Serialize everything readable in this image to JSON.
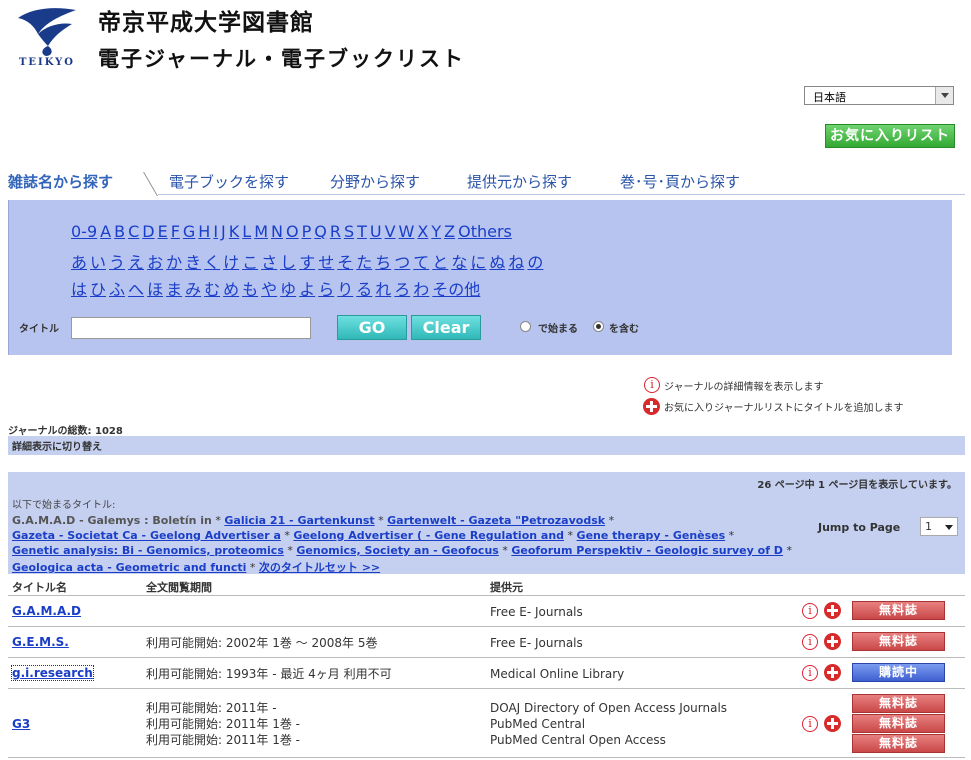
{
  "header": {
    "logo_text": "TEIKYO",
    "library_title": "帝京平成大学図書館",
    "list_title": "電子ジャーナル・電子ブックリスト",
    "language_selected": "日本語",
    "favorites_button": "お気に入りリスト"
  },
  "tabs": [
    {
      "label": "雑誌名から探す",
      "active": true
    },
    {
      "label": "電子ブックを探す",
      "active": false
    },
    {
      "label": "分野から探す",
      "active": false
    },
    {
      "label": "提供元から探す",
      "active": false
    },
    {
      "label": "巻･号･頁から探す",
      "active": false
    }
  ],
  "search": {
    "alpha_latin": [
      "0-9",
      "A",
      "B",
      "C",
      "D",
      "E",
      "F",
      "G",
      "H",
      "I",
      "J",
      "K",
      "L",
      "M",
      "N",
      "O",
      "P",
      "Q",
      "R",
      "S",
      "T",
      "U",
      "V",
      "W",
      "X",
      "Y",
      "Z",
      "Others"
    ],
    "alpha_kana1": [
      "あ",
      "い",
      "う",
      "え",
      "お",
      "か",
      "き",
      "く",
      "け",
      "こ",
      "さ",
      "し",
      "す",
      "せ",
      "そ",
      "た",
      "ち",
      "つ",
      "て",
      "と",
      "な",
      "に",
      "ぬ",
      "ね",
      "の"
    ],
    "alpha_kana2": [
      "は",
      "ひ",
      "ふ",
      "へ",
      "ほ",
      "ま",
      "み",
      "む",
      "め",
      "も",
      "や",
      "ゆ",
      "よ",
      "ら",
      "り",
      "る",
      "れ",
      "ろ",
      "わ",
      "その他"
    ],
    "title_label": "タイトル",
    "title_value": "",
    "go_button": "GO",
    "clear_button": "Clear",
    "radio_starts": "で始まる",
    "radio_contains": "を含む",
    "radio_selected": "contains"
  },
  "legend": {
    "info_text": "ジャーナルの詳細情報を表示します",
    "add_text": "お気に入りジャーナルリストにタイトルを追加します"
  },
  "total_text": "ジャーナルの総数: 1028",
  "detail_toggle": "詳細表示に切り替え",
  "index": {
    "page_info": "26 ページ中 1 ページ目を表示しています。",
    "label": "以下で始まるタイトル:",
    "line1_plain": "G.A.M.A.D - Galemys : Boletín in",
    "line1_links": [
      "Galicia 21 - Gartenkunst",
      "Gartenwelt - Gazeta \"Petrozavodsk"
    ],
    "line2_links": [
      "Gazeta - Societat Ca - Geelong Advertiser a",
      "Geelong Advertiser ( - Gene Regulation and",
      "Gene therapy - Genèses"
    ],
    "line3_links": [
      "Genetic analysis: Bi - Genomics, proteomics",
      "Genomics, Society an - Geofocus",
      "Geoforum Perspektiv - Geologic survey of D"
    ],
    "line4_links": [
      "Geologica acta - Geometric and functi"
    ],
    "next_set": "次のタイトルセット >>",
    "sep": " * ",
    "jump_label": "Jump to Page",
    "jump_value": "1"
  },
  "table": {
    "headers": {
      "title": "タイトル名",
      "period": "全文閲覧期間",
      "provider": "提供元"
    },
    "rows": [
      {
        "title": "G.A.M.A.D",
        "periods": [],
        "providers": [
          "Free E- Journals"
        ],
        "badges": [
          "無料誌"
        ]
      },
      {
        "title": "G.E.M.S.",
        "periods": [
          "利用可能開始: 2002年 1巻 〜 2008年 5巻"
        ],
        "providers": [
          "Free E- Journals"
        ],
        "badges": [
          "無料誌"
        ]
      },
      {
        "title": "g.i.research",
        "periods": [
          "利用可能開始: 1993年 - 最近 4ヶ月 利用不可"
        ],
        "providers": [
          "Medical Online Library"
        ],
        "badges": [
          "購読中"
        ]
      },
      {
        "title": "G3",
        "periods": [
          "利用可能開始: 2011年 -",
          "利用可能開始: 2011年 1巻 -",
          "利用可能開始: 2011年 1巻 -"
        ],
        "providers": [
          "DOAJ Directory of Open Access Journals",
          "PubMed Central",
          "PubMed Central Open Access"
        ],
        "badges": [
          "無料誌",
          "無料誌",
          "無料誌"
        ]
      }
    ]
  },
  "colors": {
    "panel_bg": "#b7c4ef",
    "link": "#1a3ec8",
    "free_badge": "#c94848",
    "subscribed_badge": "#3e5fd0",
    "favorites_green": "#33a833"
  }
}
